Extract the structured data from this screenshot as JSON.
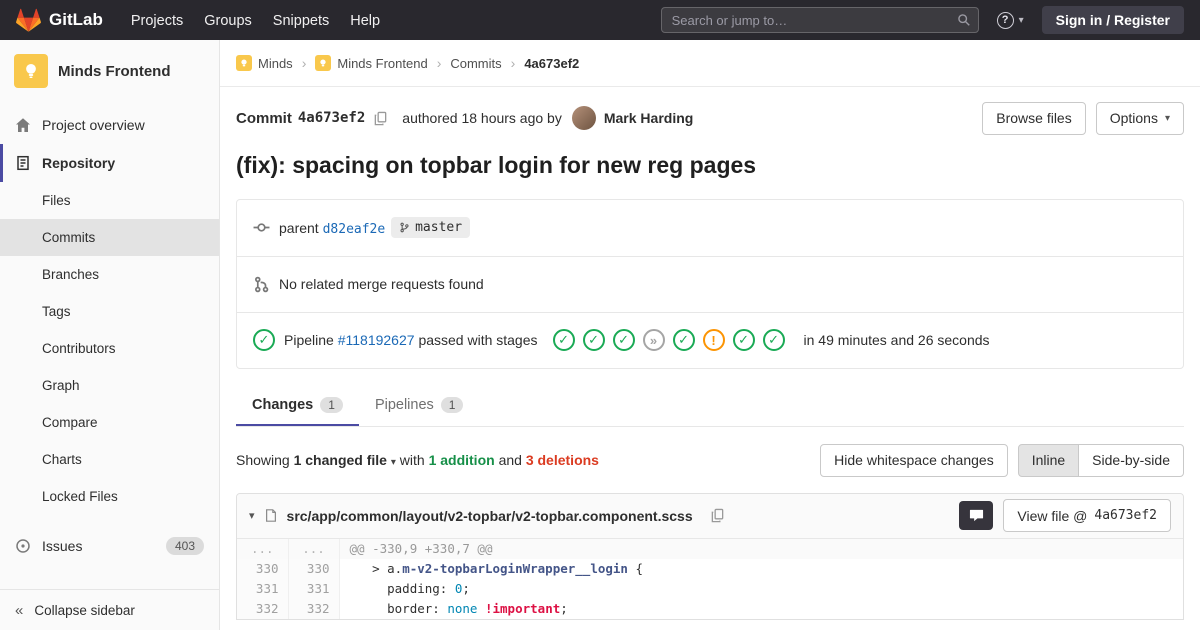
{
  "glyphs": {
    "caret": "▾",
    "collapse": "«",
    "question": "?",
    "separator": "›",
    "stage": {
      "success": "✓",
      "skipped": "»",
      "warning": "!"
    }
  },
  "navbar": {
    "brand": "GitLab",
    "menu": [
      "Projects",
      "Groups",
      "Snippets",
      "Help"
    ],
    "search": {
      "placeholder": "Search or jump to…"
    },
    "signin_label": "Sign in / Register"
  },
  "sidebar": {
    "project": {
      "name": "Minds Frontend"
    },
    "overview_label": "Project overview",
    "repository_label": "Repository",
    "repo_subitems": [
      {
        "label": "Files",
        "active": false
      },
      {
        "label": "Commits",
        "active": true
      },
      {
        "label": "Branches",
        "active": false
      },
      {
        "label": "Tags",
        "active": false
      },
      {
        "label": "Contributors",
        "active": false
      },
      {
        "label": "Graph",
        "active": false
      },
      {
        "label": "Compare",
        "active": false
      },
      {
        "label": "Charts",
        "active": false
      },
      {
        "label": "Locked Files",
        "active": false
      }
    ],
    "issues": {
      "label": "Issues",
      "count": "403"
    },
    "collapse_label": "Collapse sidebar"
  },
  "breadcrumb": {
    "items": [
      {
        "label": "Minds",
        "has_avatar": true
      },
      {
        "label": "Minds Frontend",
        "has_avatar": true
      },
      {
        "label": "Commits",
        "has_avatar": false
      }
    ],
    "current": "4a673ef2",
    "separator": "›"
  },
  "commit_header": {
    "label": "Commit",
    "sha": "4a673ef2",
    "authored_text": "authored 18 hours ago by",
    "author": "Mark Harding",
    "browse_button": "Browse files",
    "options_button": "Options"
  },
  "commit": {
    "title": "(fix): spacing on topbar login for new reg pages",
    "parent_label": "parent",
    "parent_sha": "d82eaf2e",
    "branch": "master",
    "merge_request_text": "No related merge requests found",
    "pipeline": {
      "prefix": "Pipeline",
      "id": "#118192627",
      "status_text": "passed with stages",
      "stages": [
        "success",
        "success",
        "success",
        "skipped",
        "success",
        "warning",
        "success",
        "success"
      ],
      "duration": "in 49 minutes and 26 seconds"
    }
  },
  "tabs": [
    {
      "label": "Changes",
      "count": "1",
      "active": true
    },
    {
      "label": "Pipelines",
      "count": "1",
      "active": false
    }
  ],
  "diff_meta": {
    "showing": "Showing",
    "changed_files": "1 changed file",
    "with_text": "with",
    "additions": "1 addition",
    "and_text": "and",
    "deletions": "3 deletions",
    "hide_whitespace": "Hide whitespace changes",
    "inline": "Inline",
    "side_by_side": "Side-by-side"
  },
  "diff_file": {
    "path": "src/app/common/layout/v2-topbar/v2-topbar.component.scss",
    "view_file_label": "View file @",
    "view_file_sha": "4a673ef2",
    "hunk": {
      "old": "...",
      "new": "...",
      "text": "@@ -330,9 +330,7 @@"
    },
    "lines": [
      {
        "old": "330",
        "new": "330",
        "tokens": [
          {
            "t": "   > a.",
            "c": "p"
          },
          {
            "t": "m-v2-topbarLoginWrapper__login",
            "c": "nc"
          },
          {
            "t": " {",
            "c": "p"
          }
        ]
      },
      {
        "old": "331",
        "new": "331",
        "tokens": [
          {
            "t": "     padding: ",
            "c": "p"
          },
          {
            "t": "0",
            "c": "mi"
          },
          {
            "t": ";",
            "c": "p"
          }
        ]
      },
      {
        "old": "332",
        "new": "332",
        "tokens": [
          {
            "t": "     border: ",
            "c": "p"
          },
          {
            "t": "none",
            "c": "kw"
          },
          {
            "t": " ",
            "c": "p"
          },
          {
            "t": "!important",
            "c": "imp"
          },
          {
            "t": ";",
            "c": "p"
          }
        ]
      }
    ]
  }
}
